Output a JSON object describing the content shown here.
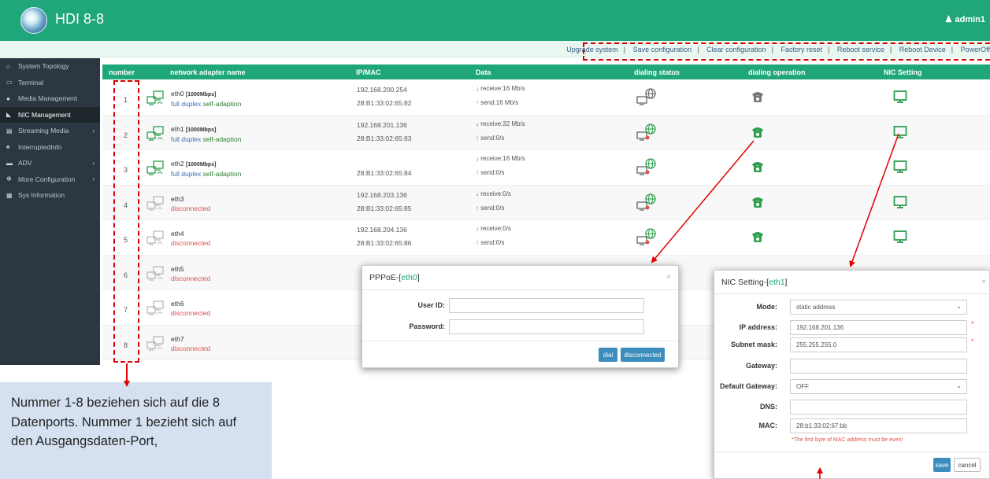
{
  "header": {
    "title": "HDI 8-8",
    "user": "admin1"
  },
  "toolbar": {
    "items": [
      "Upgrade system",
      "Save configuration",
      "Clear configuration",
      "Factory reset",
      "Reboot service",
      "Reboot Device",
      "PowerOff"
    ],
    "separator": "|"
  },
  "sidebar": {
    "items": [
      {
        "label": "System Topology",
        "icon": "home-icon"
      },
      {
        "label": "Terminal",
        "icon": "monitor-icon"
      },
      {
        "label": "Media Management",
        "icon": "circle-icon"
      },
      {
        "label": "NIC Management",
        "icon": "signal-icon"
      },
      {
        "label": "Streaming Media",
        "icon": "film-icon"
      },
      {
        "label": "InterruptedInfo",
        "icon": "bell-icon"
      },
      {
        "label": "ADV",
        "icon": "card-icon"
      },
      {
        "label": "More Configuration",
        "icon": "gears-icon"
      },
      {
        "label": "Sys Information",
        "icon": "table-icon"
      }
    ]
  },
  "table": {
    "headers": [
      "number",
      "network adapter name",
      "IP/MAC",
      "Data",
      "dialing status",
      "dialing operation",
      "NIC Setting"
    ],
    "rows": [
      {
        "number": "1",
        "name": "eth0",
        "speed": "[1000Mbps]",
        "duplex": "full duplex",
        "mode": "self-adaption",
        "ip": "192.168.200.254",
        "mac": "28:B1:33:02:65:82",
        "receive": "receive:16 Mb/s",
        "send": "send:16 Mb/s"
      },
      {
        "number": "2",
        "name": "eth1",
        "speed": "[1000Mbps]",
        "duplex": "full duplex",
        "mode": "self-adaption",
        "ip": "192.168.201.136",
        "mac": "28:B1:33:02:65:83",
        "receive": "receive:32 Mb/s",
        "send": "send:0/s"
      },
      {
        "number": "3",
        "name": "eth2",
        "speed": "[1000Mbps]",
        "duplex": "full duplex",
        "mode": "self-adaption",
        "ip": "",
        "mac": "28:B1:33:02:65:84",
        "receive": "receive:16 Mb/s",
        "send": "send:0/s"
      },
      {
        "number": "4",
        "name": "eth3",
        "status": "disconnected",
        "ip": "192.168.203.136",
        "mac": "28:B1:33:02:65:85",
        "receive": "receive:0/s",
        "send": "send:0/s"
      },
      {
        "number": "5",
        "name": "eth4",
        "status": "disconnected",
        "ip": "192.168.204.136",
        "mac": "28:B1:33:02:65:86",
        "receive": "receive:0/s",
        "send": "send:0/s"
      },
      {
        "number": "6",
        "name": "eth5",
        "status": "disconnected"
      },
      {
        "number": "7",
        "name": "eth6",
        "status": "disconnected"
      },
      {
        "number": "8",
        "name": "eth7",
        "status": "disconnected"
      }
    ]
  },
  "pppoe_dialog": {
    "title_prefix": "PPPoE-[",
    "iface": "eth0",
    "title_suffix": "]",
    "close": "×",
    "user_label": "User ID:",
    "password_label": "Password:",
    "dial": "dial",
    "disconnect": "disconnected"
  },
  "nic_dialog": {
    "title_prefix": "NIC Setting-[",
    "iface": "eth1",
    "title_suffix": "]",
    "close": "×",
    "mode_label": "Mode:",
    "mode_value": "static address",
    "ip_label": "IP address:",
    "ip_value": "192.168.201.136",
    "subnet_label": "Subnet mask:",
    "subnet_value": "255.255.255.0",
    "gateway_label": "Gateway:",
    "gateway_value": "",
    "default_gw_label": "Default Gateway:",
    "default_gw_value": "OFF",
    "dns_label": "DNS:",
    "dns_value": "",
    "mac_label": "MAC:",
    "mac_value": "28:b1:33:02:67:bb",
    "mac_warning": "*The first byte of MAC address must be even!",
    "required": "*",
    "save": "save",
    "cancel": "cancel"
  },
  "note": {
    "text": "Nummer 1-8 beziehen sich auf die 8 Datenports. Nummer 1 bezieht sich auf den Ausgangsdaten-Port,"
  },
  "colors": {
    "header": "#1fa67a",
    "sidebar": "#2d3741",
    "annotation": "#d40000",
    "note_bg": "#d5e1f1"
  }
}
